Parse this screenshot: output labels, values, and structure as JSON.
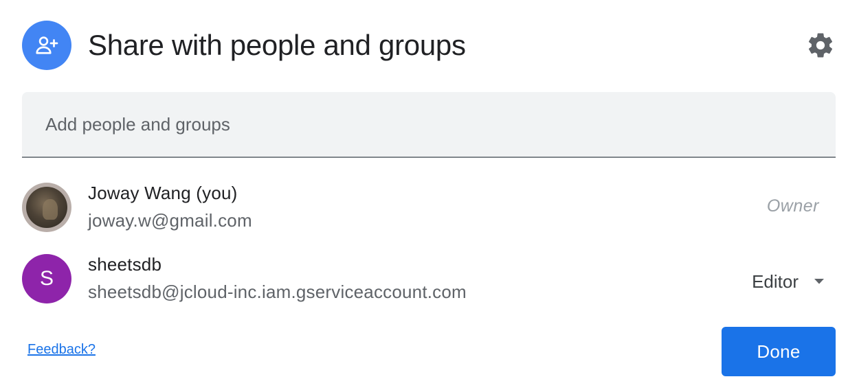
{
  "dialog": {
    "title": "Share with people and groups",
    "header_icon": "person-add-icon",
    "settings_icon": "gear-icon"
  },
  "add_field": {
    "placeholder": "Add people and groups"
  },
  "people": [
    {
      "name": "Joway Wang (you)",
      "email": "joway.w@gmail.com",
      "avatar": "photo",
      "role": "Owner"
    },
    {
      "name": "sheetsdb",
      "email": "sheetsdb@jcloud-inc.iam.gserviceaccount.com",
      "avatar_letter": "S",
      "role": "Editor",
      "role_icon": "dropdown-arrow-icon"
    }
  ],
  "footer": {
    "feedback_label": "Feedback?",
    "done_label": "Done"
  },
  "colors": {
    "accent": "#1a73e8",
    "header_icon_bg": "#4285f4",
    "avatar_purple": "#8e24aa",
    "field_bg": "#f1f3f4"
  }
}
